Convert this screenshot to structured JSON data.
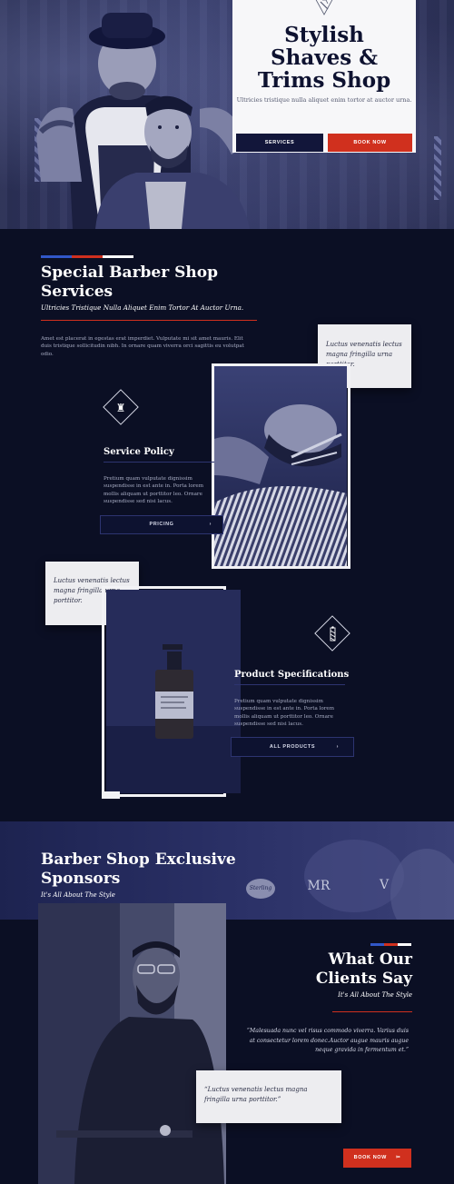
{
  "hero": {
    "title_lines": [
      "Stylish",
      "Shaves &",
      "Trims Shop"
    ],
    "subtitle": "Ultricies tristique nulla aliquet enim tortor at auctor urna.",
    "services_btn": "SERVICES",
    "book_btn": "BOOK NOW"
  },
  "services": {
    "title_lines": [
      "Special Barber Shop",
      "Services"
    ],
    "tagline": "Ultricies Tristique Nulla Aliquet Enim Tortor At Auctor Urna.",
    "body": "Amet est placerat in egestas erat imperdiet. Vulputate mi sit amet mauris. Elit duis tristique sollicitudin nibh. In ornare quam viverra orci sagittis eu volutpat odio.",
    "quote1": "Luctus venenatis lectus magna fringilla urna porttitor.",
    "policy_title": "Service Policy",
    "policy_body": "Pretium quam vulputate dignissim suspendisse in est ante in. Porta lorem mollis aliquam ut porttitor leo. Ornare suspendisse sed nisi lacus.",
    "pricing_btn": "PRICING",
    "quote2": "Luctus venenatis lectus magna fringilla urna porttitor.",
    "product_title": "Product Specifications",
    "product_body": "Pretium quam vulputate dignissim suspendisse in est ante in. Porta lorem mollis aliquam ut porttitor leo. Ornare suspendisse sed nisi lacus.",
    "products_btn": "ALL PRODUCTS",
    "arrow": "›"
  },
  "sponsors": {
    "title_lines": [
      "Barber Shop Exclusive",
      "Sponsors"
    ],
    "tagline": "It's All About The Style",
    "logos": [
      "Sterling",
      "MR",
      "V"
    ]
  },
  "testimonials": {
    "title_lines": [
      "What Our",
      "Clients Say"
    ],
    "tagline": "It's All About The Style",
    "quote": "“Malesuada nunc vel risus commodo viverra. Varius duis at consectetur lorem donec.Auctor augue mauris augue neque gravida in fermentum et.”",
    "card_quote": "“Luctus venenatis lectus magna fringilla urna porttitor.”",
    "book_btn": "BOOK NOW",
    "scissors": "✂"
  },
  "colors": {
    "navy": "#0b0f24",
    "red": "#d0301e",
    "blue": "#3157c8",
    "white": "#ffffff"
  },
  "icons": [
    "razor-icon",
    "barber-chair-icon",
    "barber-pole-icon",
    "scissors-icon",
    "chevron-right-icon"
  ]
}
